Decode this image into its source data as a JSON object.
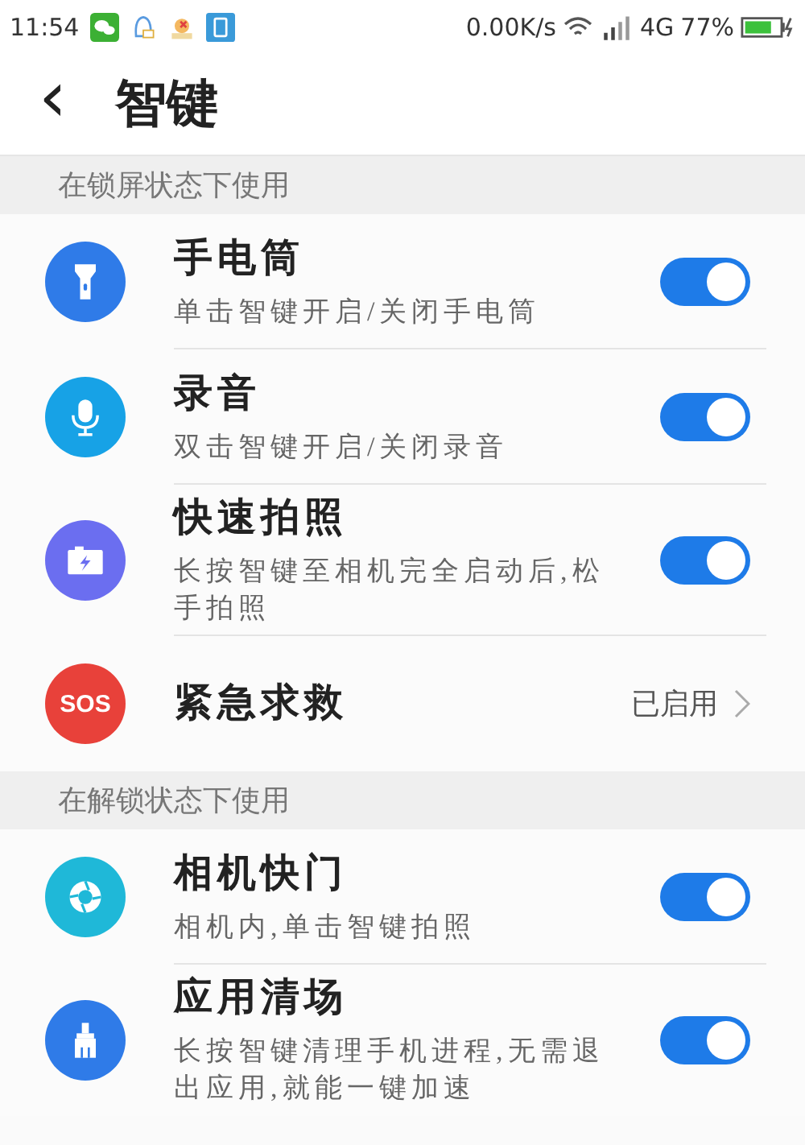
{
  "status_bar": {
    "time": "11:54",
    "speed": "0.00K/s",
    "network": "4G",
    "battery": "77%"
  },
  "header": {
    "back": "‹",
    "title": "智键"
  },
  "sections": [
    {
      "title": "在锁屏状态下使用",
      "items": [
        {
          "kind": "toggle",
          "color": "#2f7be8",
          "title": "手电筒",
          "desc": "单击智键开启/关闭手电筒",
          "on": true
        },
        {
          "kind": "toggle",
          "color": "#17a2e6",
          "title": "录音",
          "desc": "双击智键开启/关闭录音",
          "on": true
        },
        {
          "kind": "toggle",
          "color": "#6b6ef0",
          "title": "快速拍照",
          "desc": "长按智键至相机完全启动后,松手拍照",
          "on": true
        },
        {
          "kind": "link",
          "color": "#e8413a",
          "title": "紧急求救",
          "icon_text": "SOS",
          "value": "已启用"
        }
      ]
    },
    {
      "title": "在解锁状态下使用",
      "items": [
        {
          "kind": "toggle",
          "color": "#1fb8d8",
          "title": "相机快门",
          "desc": "相机内,单击智键拍照",
          "on": true
        },
        {
          "kind": "toggle",
          "color": "#2f7be8",
          "title": "应用清场",
          "desc": "长按智键清理手机进程,无需退出应用,就能一键加速",
          "on": true
        }
      ]
    }
  ]
}
